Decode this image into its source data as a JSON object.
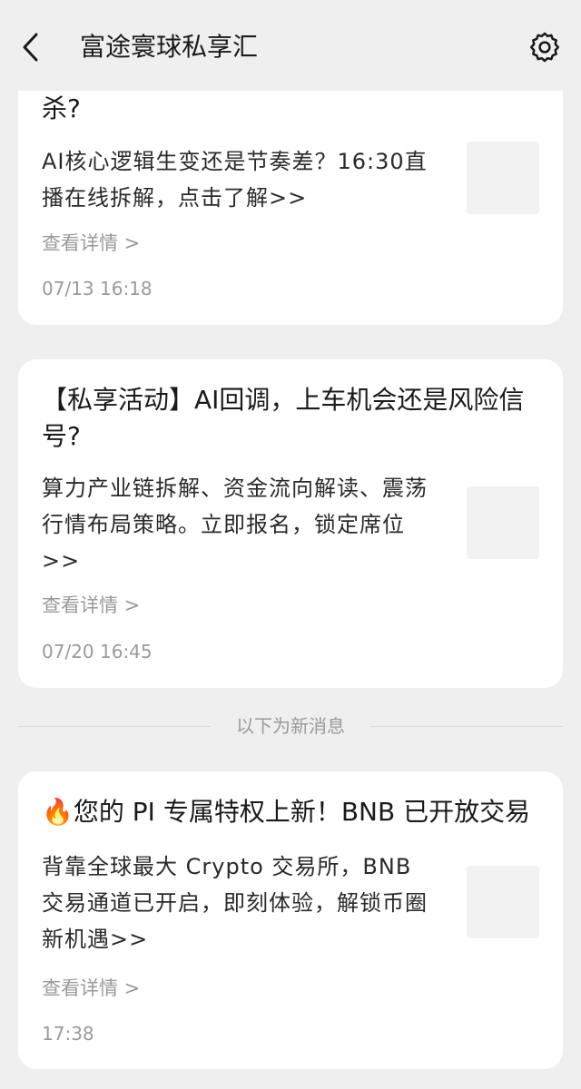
{
  "header": {
    "title": "富途寰球私享汇",
    "back_icon": "chevron-left-icon",
    "settings_icon": "gear-icon"
  },
  "cards": [
    {
      "title": "杀?",
      "body": "AI核心逻辑生变还是节奏差？16:30直播在线拆解，点击了解>>",
      "details": "查看详情 >",
      "time": "07/13 16:18"
    },
    {
      "title": "【私享活动】AI回调，上车机会还是风险信号?",
      "body": "算力产业链拆解、资金流向解读、震荡行情布局策略。立即报名，锁定席位>>",
      "details": "查看详情 >",
      "time": "07/20 16:45"
    },
    {
      "title_emoji": "🔥",
      "title": "您的 PI 专属特权上新！BNB 已开放交易",
      "body": "背靠全球最大 Crypto 交易所，BNB 交易通道已开启，即刻体验，解锁币圈新机遇>>",
      "details": "查看详情 >",
      "time": "17:38"
    }
  ],
  "divider": {
    "text": "以下为新消息"
  }
}
